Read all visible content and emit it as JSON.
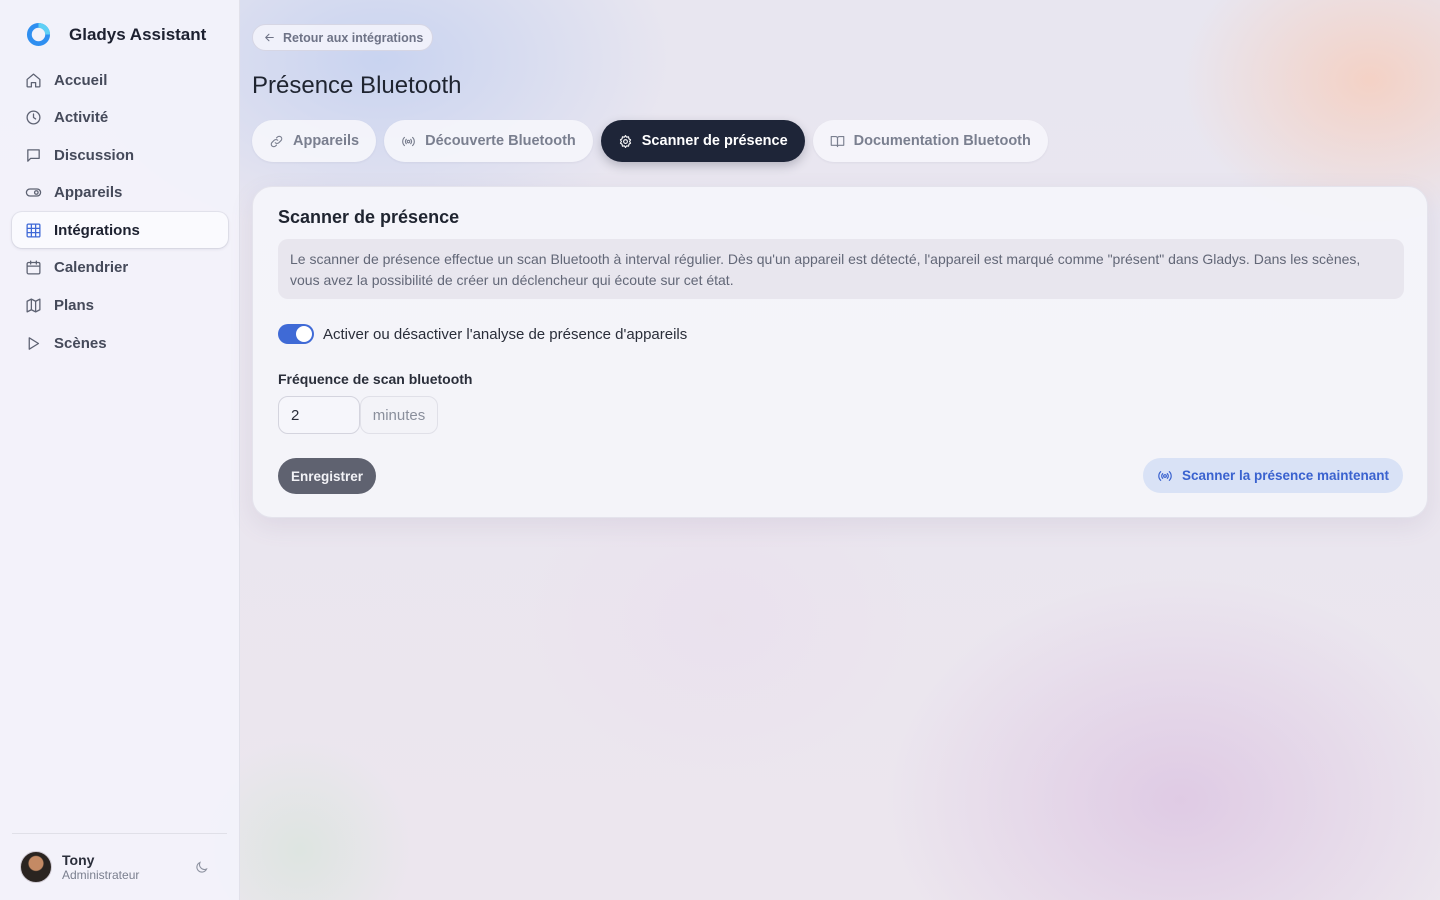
{
  "app": {
    "name": "Gladys Assistant"
  },
  "sidebar": {
    "items": [
      {
        "label": "Accueil",
        "icon": "home-icon"
      },
      {
        "label": "Activité",
        "icon": "clock-icon"
      },
      {
        "label": "Discussion",
        "icon": "chat-icon"
      },
      {
        "label": "Appareils",
        "icon": "toggle-icon"
      },
      {
        "label": "Intégrations",
        "icon": "grid-icon",
        "active": true
      },
      {
        "label": "Calendrier",
        "icon": "calendar-icon"
      },
      {
        "label": "Plans",
        "icon": "map-icon"
      },
      {
        "label": "Scènes",
        "icon": "play-icon"
      }
    ]
  },
  "user": {
    "name": "Tony",
    "role": "Administrateur"
  },
  "header": {
    "back_label": "Retour aux intégrations",
    "title": "Présence Bluetooth"
  },
  "tabs": [
    {
      "label": "Appareils",
      "icon": "link-icon"
    },
    {
      "label": "Découverte Bluetooth",
      "icon": "broadcast-icon"
    },
    {
      "label": "Scanner de présence",
      "icon": "gear-icon",
      "active": true
    },
    {
      "label": "Documentation Bluetooth",
      "icon": "book-icon"
    }
  ],
  "card": {
    "title": "Scanner de présence",
    "description": "Le scanner de présence effectue un scan Bluetooth à interval régulier. Dès qu'un appareil est détecté, l'appareil est marqué comme \"présent\" dans Gladys. Dans les scènes, vous avez la possibilité de créer un déclencheur qui écoute sur cet état.",
    "toggle_label": "Activer ou désactiver l'analyse de présence d'appareils",
    "toggle_on": true,
    "frequency_label": "Fréquence de scan bluetooth",
    "frequency_value": "2",
    "frequency_unit": "minutes",
    "save_label": "Enregistrer",
    "scan_now_label": "Scanner la présence maintenant"
  },
  "colors": {
    "accent": "#3f6ad6",
    "active_tab": "#1e2538",
    "save_button": "#5f6270"
  }
}
